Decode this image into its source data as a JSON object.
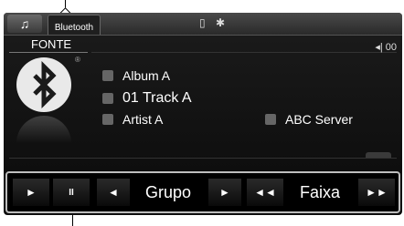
{
  "tabs": {
    "music_icon": "♫",
    "bluetooth_label": "Bluetooth"
  },
  "status": {
    "icons": "▯ ✱",
    "volume": "◂| 00"
  },
  "source": {
    "label": "FONTE",
    "registered_mark": "®"
  },
  "media": {
    "album": "Album A",
    "track": "01  Track A",
    "artist": "Artist A",
    "server": "ABC Server"
  },
  "controls": {
    "play": "►",
    "pause": "II",
    "group_prev": "◄",
    "group_label": "Grupo",
    "group_next": "►",
    "track_prev": "◄◄",
    "track_label": "Faixa",
    "track_next": "►►"
  },
  "colors": {
    "screen_bg": "#0d0d0d",
    "text": "#ffffff",
    "frame": "#bdbdbd"
  }
}
